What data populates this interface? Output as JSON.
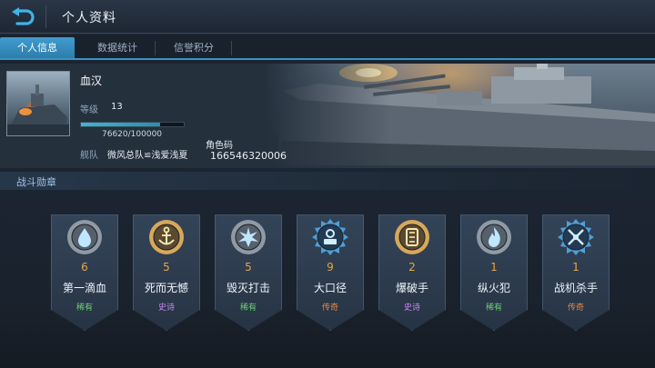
{
  "header": {
    "title": "个人资料",
    "back_icon": "back-arrow-icon"
  },
  "tabs": [
    {
      "label": "个人信息",
      "active": true
    },
    {
      "label": "数据统计",
      "active": false
    },
    {
      "label": "信誉积分",
      "active": false
    }
  ],
  "profile": {
    "name": "血汉",
    "level_label": "等级",
    "level": "13",
    "xp_text": "76620/100000",
    "xp_progress": 0.7662,
    "fleet_label": "舰队",
    "fleet_name": "微风总队≌浅爱浅夏",
    "role_code_label": "角色码",
    "role_code": "166546320006"
  },
  "section": {
    "title": "战斗勋章"
  },
  "colors": {
    "accent": "#3a93c2",
    "count": "#e7a646",
    "rare": "#6fd07a",
    "epic": "#c987f0",
    "legendary": "#f08a3c"
  },
  "medals": [
    {
      "count": "6",
      "name": "第一滴血",
      "rarity": "稀有",
      "rarity_type": "rare",
      "icon": "droplet-emblem-icon",
      "frame": "silver"
    },
    {
      "count": "5",
      "name": "死而无憾",
      "rarity": "史诗",
      "rarity_type": "epic",
      "icon": "anchor-emblem-icon",
      "frame": "gold"
    },
    {
      "count": "5",
      "name": "毁灭打击",
      "rarity": "稀有",
      "rarity_type": "rare",
      "icon": "explosion-emblem-icon",
      "frame": "silver"
    },
    {
      "count": "9",
      "name": "大口径",
      "rarity": "传奇",
      "rarity_type": "legendary",
      "icon": "cannon-emblem-icon",
      "frame": "blue"
    },
    {
      "count": "2",
      "name": "爆破手",
      "rarity": "史诗",
      "rarity_type": "epic",
      "icon": "torpedo-emblem-icon",
      "frame": "gold"
    },
    {
      "count": "1",
      "name": "纵火犯",
      "rarity": "稀有",
      "rarity_type": "rare",
      "icon": "flame-emblem-icon",
      "frame": "silver"
    },
    {
      "count": "1",
      "name": "战机杀手",
      "rarity": "传奇",
      "rarity_type": "legendary",
      "icon": "crossed-planes-emblem-icon",
      "frame": "blue"
    }
  ]
}
